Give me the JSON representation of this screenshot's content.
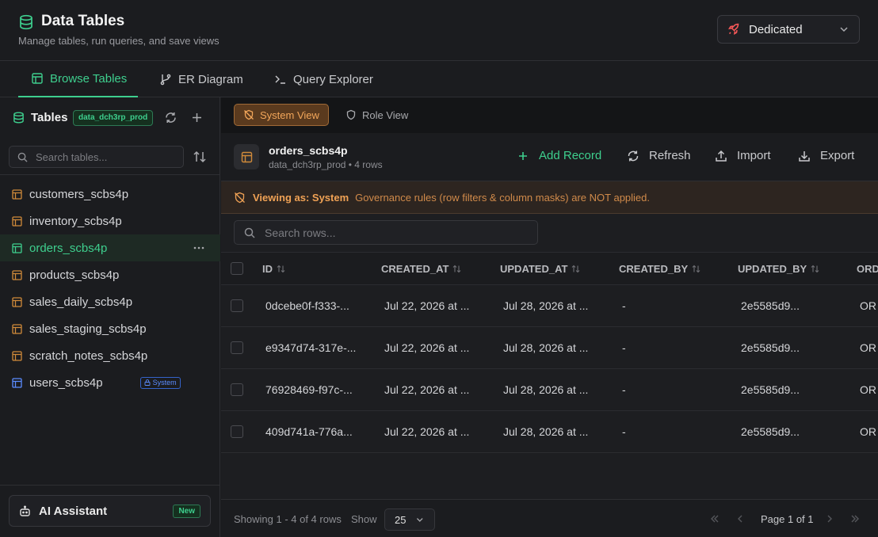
{
  "app": {
    "title": "Data Tables",
    "subtitle": "Manage tables, run queries, and save views",
    "env_label": "Dedicated"
  },
  "tabs": [
    {
      "label": "Browse Tables",
      "active": true
    },
    {
      "label": "ER Diagram",
      "active": false
    },
    {
      "label": "Query Explorer",
      "active": false
    }
  ],
  "sidebar": {
    "title": "Tables",
    "db_badge": "data_dch3rp_prod",
    "search_placeholder": "Search tables...",
    "tables": [
      {
        "name": "customers_scbs4p",
        "active": false
      },
      {
        "name": "inventory_scbs4p",
        "active": false
      },
      {
        "name": "orders_scbs4p",
        "active": true
      },
      {
        "name": "products_scbs4p",
        "active": false
      },
      {
        "name": "sales_daily_scbs4p",
        "active": false
      },
      {
        "name": "sales_staging_scbs4p",
        "active": false
      },
      {
        "name": "scratch_notes_scbs4p",
        "active": false
      },
      {
        "name": "users_scbs4p",
        "active": false,
        "badge": "System"
      }
    ],
    "ai_label": "AI Assistant",
    "ai_badge": "New"
  },
  "viewbar": {
    "system_label": "System View",
    "role_label": "Role View"
  },
  "table_header": {
    "name": "orders_scbs4p",
    "meta": "data_dch3rp_prod • 4 rows",
    "add_label": "Add Record",
    "refresh_label": "Refresh",
    "import_label": "Import",
    "export_label": "Export"
  },
  "warning": {
    "strong": "Viewing as: System",
    "text": "Governance rules (row filters & column masks) are NOT applied."
  },
  "rows_search_placeholder": "Search rows...",
  "grid": {
    "columns": [
      "ID",
      "CREATED_AT",
      "UPDATED_AT",
      "CREATED_BY",
      "UPDATED_BY",
      "ORD"
    ],
    "rows": [
      [
        "0dcebe0f-f333-...",
        "Jul 22, 2026 at ...",
        "Jul 28, 2026 at ...",
        "-",
        "2e5585d9...",
        "OR"
      ],
      [
        "e9347d74-317e-...",
        "Jul 22, 2026 at ...",
        "Jul 28, 2026 at ...",
        "-",
        "2e5585d9...",
        "OR"
      ],
      [
        "76928469-f97c-...",
        "Jul 22, 2026 at ...",
        "Jul 28, 2026 at ...",
        "-",
        "2e5585d9...",
        "OR"
      ],
      [
        "409d741a-776a...",
        "Jul 22, 2026 at ...",
        "Jul 28, 2026 at ...",
        "-",
        "2e5585d9...",
        "OR"
      ]
    ]
  },
  "footer": {
    "showing": "Showing 1 - 4 of 4 rows",
    "show_label": "Show",
    "page_size": "25",
    "page_text": "Page 1 of 1"
  },
  "colors": {
    "accent": "#3ecf8e",
    "warning": "#f0a255",
    "system_badge": "#5b8cff",
    "table_icon": "#d08a3a"
  }
}
